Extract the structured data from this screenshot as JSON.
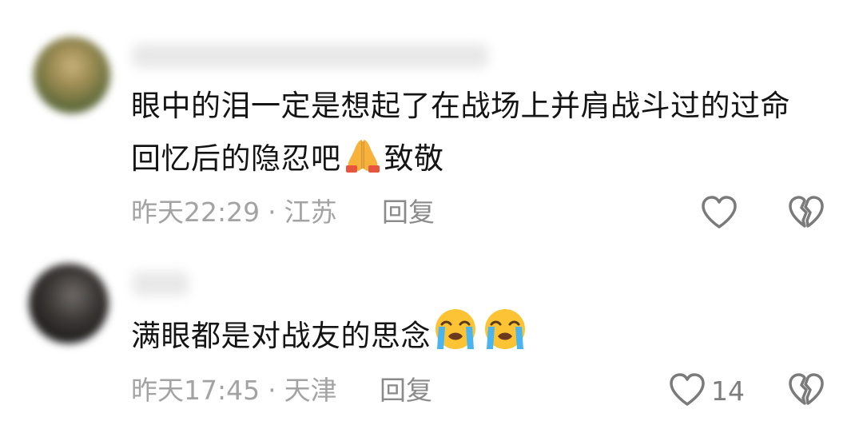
{
  "comments": [
    {
      "text_before_emoji": "眼中的泪一定是想起了在战场上并肩战斗过的过命回忆后的隐忍吧",
      "emoji": "folded-hands",
      "text_after_emoji": "致敬",
      "time": "昨天22:29",
      "separator": "·",
      "location": "江苏",
      "reply_label": "回复",
      "like_count": "",
      "like_icon": "heart-outline-icon",
      "dislike_icon": "broken-heart-outline-icon"
    },
    {
      "text_before_emoji": "满眼都是对战友的思念",
      "emoji": "loudly-crying-face x2",
      "text_after_emoji": "",
      "time": "昨天17:45",
      "separator": "·",
      "location": "天津",
      "reply_label": "回复",
      "like_count": "14",
      "like_icon": "heart-outline-icon",
      "dislike_icon": "broken-heart-outline-icon"
    }
  ],
  "colors": {
    "text": "#141414",
    "meta": "#a3a3a3",
    "reply": "#8a8a8a",
    "icon": "#7a7a7a"
  }
}
